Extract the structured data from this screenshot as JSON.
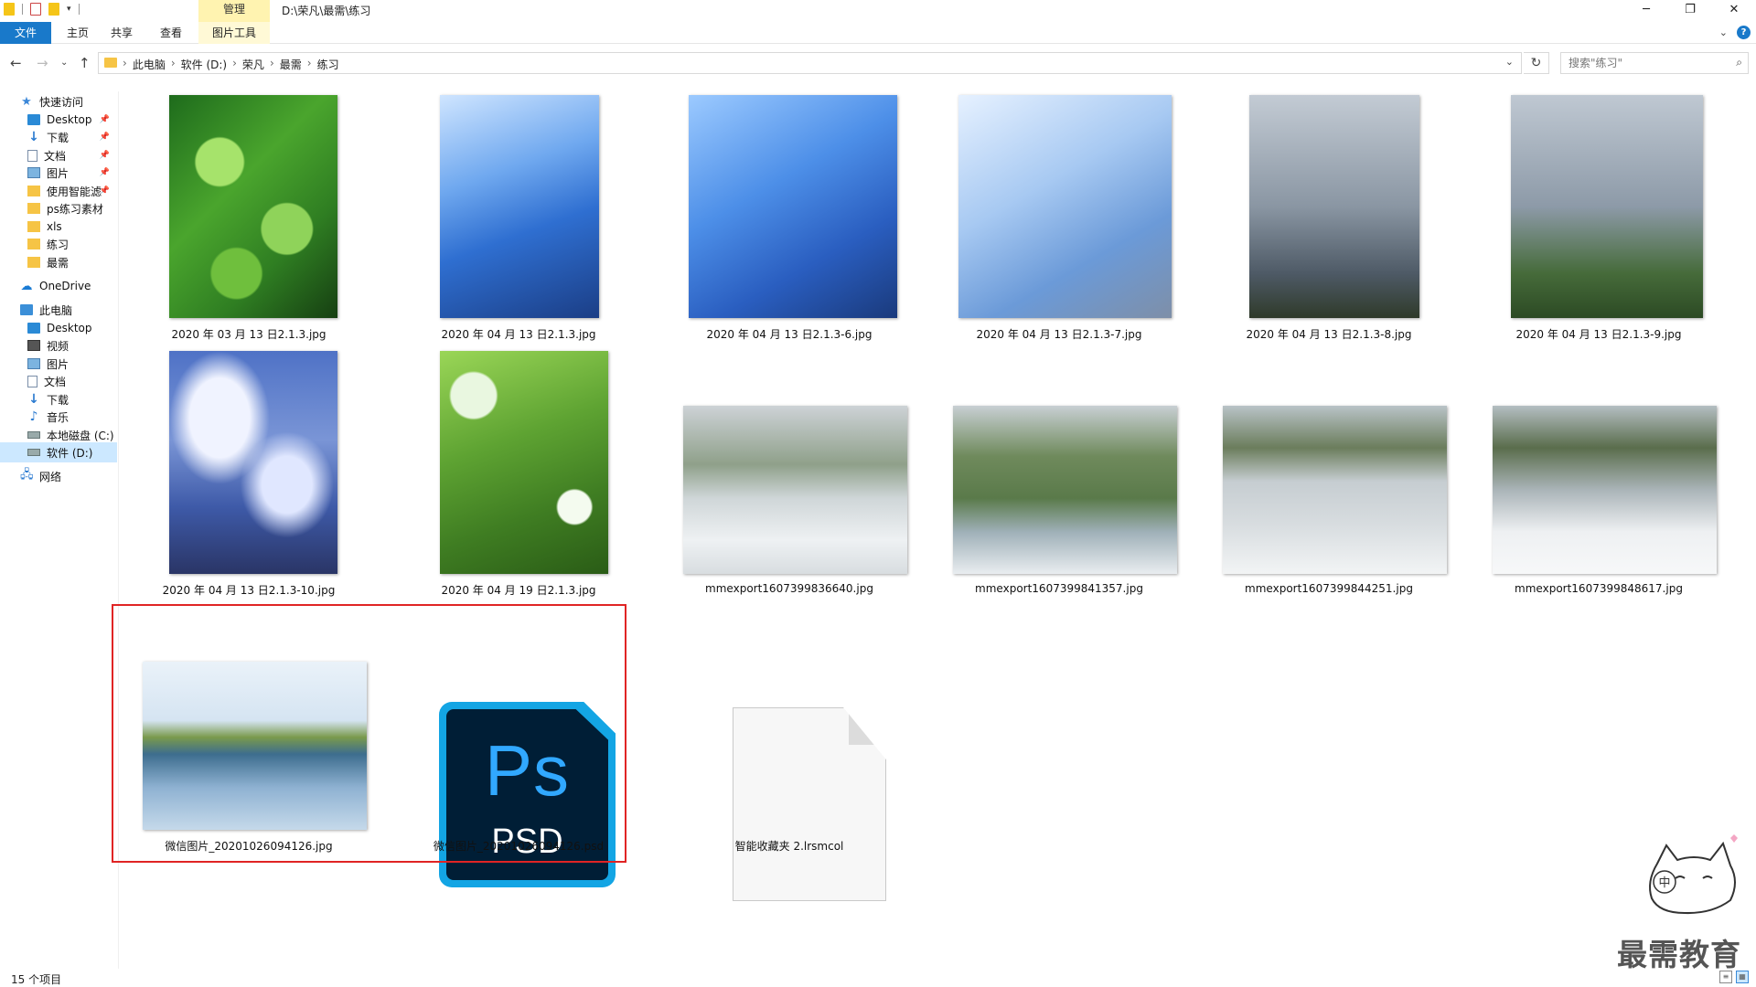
{
  "titlebar": {
    "tool_header": "管理",
    "path_title": "D:\\荣凡\\最需\\练习",
    "minimize": "─",
    "maximize": "❐",
    "close": "✕"
  },
  "ribbon": {
    "tabs": [
      "文件",
      "主页",
      "共享",
      "查看",
      "图片工具"
    ]
  },
  "address": {
    "crumbs": [
      "此电脑",
      "软件 (D:)",
      "荣凡",
      "最需",
      "练习"
    ],
    "search_placeholder": "搜索\"练习\""
  },
  "nav": {
    "items": [
      {
        "label": "快速访问",
        "icon": "star-icon"
      },
      {
        "label": "Desktop",
        "icon": "desktop-icon",
        "pinned": true
      },
      {
        "label": "下载",
        "icon": "download-icon",
        "pinned": true
      },
      {
        "label": "文档",
        "icon": "document-icon",
        "pinned": true
      },
      {
        "label": "图片",
        "icon": "pictures-icon",
        "pinned": true
      },
      {
        "label": "使用智能滤",
        "icon": "folder-icon",
        "pinned": true
      },
      {
        "label": "ps练习素材",
        "icon": "folder-icon"
      },
      {
        "label": "xls",
        "icon": "folder-icon"
      },
      {
        "label": "练习",
        "icon": "folder-icon"
      },
      {
        "label": "最需",
        "icon": "folder-icon"
      },
      {
        "label": "OneDrive",
        "icon": "cloud-icon"
      },
      {
        "label": "此电脑",
        "icon": "computer-icon"
      },
      {
        "label": "Desktop",
        "icon": "desktop-icon"
      },
      {
        "label": "视频",
        "icon": "video-icon"
      },
      {
        "label": "图片",
        "icon": "pictures-icon"
      },
      {
        "label": "文档",
        "icon": "document-icon"
      },
      {
        "label": "下载",
        "icon": "download-icon"
      },
      {
        "label": "音乐",
        "icon": "music-icon"
      },
      {
        "label": "本地磁盘 (C:)",
        "icon": "drive-icon"
      },
      {
        "label": "软件 (D:)",
        "icon": "drive-icon",
        "selected": true
      },
      {
        "label": "网络",
        "icon": "network-icon"
      }
    ]
  },
  "files": [
    {
      "name": "2020 年 03 月 13 日2.1.3.jpg"
    },
    {
      "name": "2020 年 04 月 13 日2.1.3.jpg"
    },
    {
      "name": "2020 年 04 月 13 日2.1.3-6.jpg"
    },
    {
      "name": "2020 年 04 月 13 日2.1.3-7.jpg"
    },
    {
      "name": "2020 年 04 月 13 日2.1.3-8.jpg"
    },
    {
      "name": "2020 年 04 月 13 日2.1.3-9.jpg"
    },
    {
      "name": "2020 年 04 月 13 日2.1.3-10.jpg"
    },
    {
      "name": "2020 年 04 月 19 日2.1.3.jpg"
    },
    {
      "name": "mmexport1607399836640.jpg"
    },
    {
      "name": "mmexport1607399841357.jpg"
    },
    {
      "name": "mmexport1607399844251.jpg"
    },
    {
      "name": "mmexport1607399848617.jpg"
    },
    {
      "name": "微信图片_20201026094126.jpg"
    },
    {
      "name": "微信图片_20201026094126.psd",
      "icon_text_main": "Ps",
      "icon_text_sub": "PSD"
    },
    {
      "name": "智能收藏夹 2.lrsmcol"
    }
  ],
  "status": {
    "count": "15 个项目"
  },
  "watermark": {
    "brand": "最需教育",
    "mascot_text": "中"
  },
  "colors": {
    "accent": "#1979ca",
    "highlight_box": "#e02424",
    "psd_blue": "#31a8ff",
    "psd_bg": "#001e36"
  }
}
